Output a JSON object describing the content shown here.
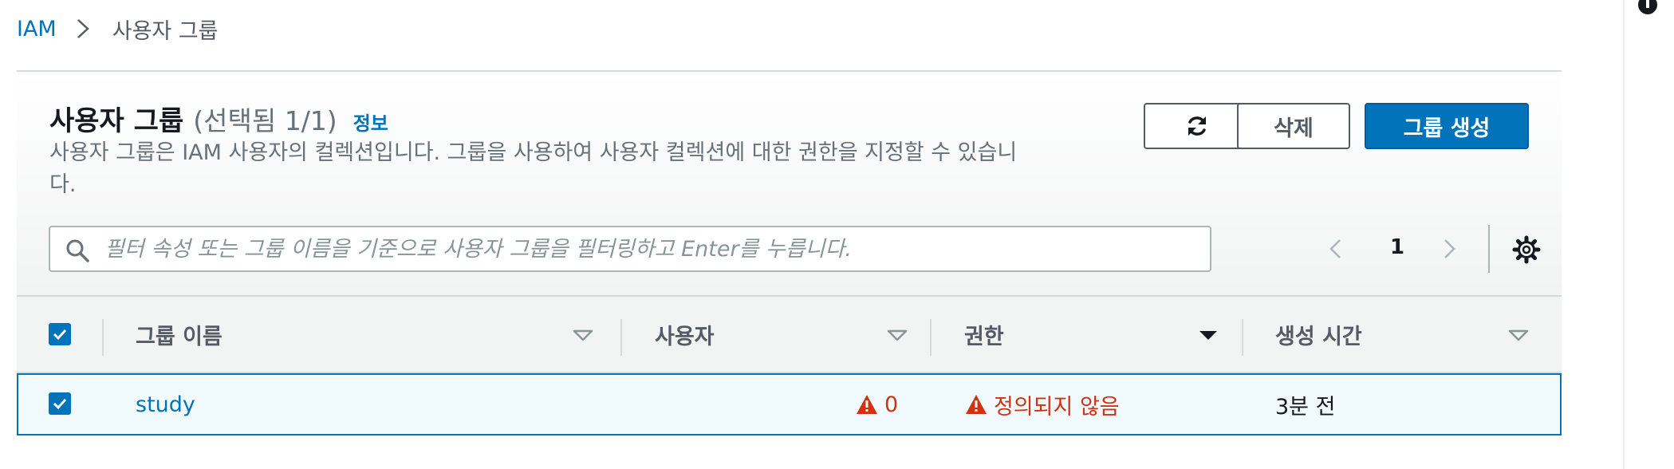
{
  "breadcrumb": {
    "root": "IAM",
    "current": "사용자 그룹"
  },
  "header": {
    "title": "사용자 그룹",
    "selection_count": "(선택됨 1/1)",
    "info_link": "정보",
    "description": "사용자 그룹은 IAM 사용자의 컬렉션입니다. 그룹을 사용하여 사용자 컬렉션에 대한 권한을 지정할 수 있습니다."
  },
  "actions": {
    "delete_label": "삭제",
    "create_label": "그룹 생성",
    "refresh_icon": "refresh-icon"
  },
  "search": {
    "placeholder": "필터 속성 또는 그룹 이름을 기준으로 사용자 그룹을 필터링하고 Enter를 누릅니다.",
    "value": ""
  },
  "pagination": {
    "current_page": "1"
  },
  "table": {
    "select_all_checked": true,
    "columns": [
      {
        "label": "그룹 이름",
        "sort": "unsorted"
      },
      {
        "label": "사용자",
        "sort": "unsorted"
      },
      {
        "label": "권한",
        "sort": "sorted"
      },
      {
        "label": "생성 시간",
        "sort": "unsorted"
      }
    ],
    "rows": [
      {
        "checked": true,
        "name": "study",
        "users": "0",
        "permissions": "정의되지 않음",
        "created": "3분 전"
      }
    ]
  },
  "colors": {
    "link": "#0073bb",
    "primary": "#0073bb",
    "warning": "#d13212",
    "selected_row_bg": "#f1faff"
  }
}
